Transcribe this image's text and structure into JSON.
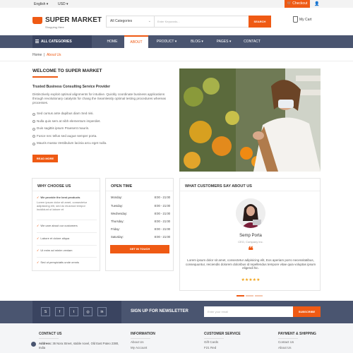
{
  "topbar": {
    "language": "English",
    "currency": "USD",
    "checkout": "Checkout"
  },
  "header": {
    "logo_name": "SUPER MARKET",
    "logo_tagline": "Shopping Here",
    "search_category": "All Categories",
    "search_placeholder": "Enter Keywords...",
    "search_button": "SEARCH",
    "cart_label": "My Cart"
  },
  "nav": {
    "all_categories": "ALL CATEGORIES",
    "items": [
      {
        "label": "HOME"
      },
      {
        "label": "ABOUT",
        "active": true
      },
      {
        "label": "PRODUCT ▾"
      },
      {
        "label": "BLOG ▾"
      },
      {
        "label": "PAGES ▾"
      },
      {
        "label": "CONTACT"
      }
    ]
  },
  "breadcrumb": {
    "home": "Home",
    "sep": "|",
    "current": "About Us"
  },
  "welcome": {
    "title": "WELCOME TO SUPER MARKET",
    "subtitle": "Trusted Business Consulting Service Provider",
    "paragraph": "Distinctively exploit optimal alignments for intuitive. Quickly coordinate business applications through revolutionary catalysts for chang the Seamlessly optimal testing procedures whereas processes.",
    "bullets": [
      "Sed cursus ante dapibus diam Sed nisi.",
      "Nulla quis sem at nibh elementum imperdiet.",
      "Duis sagittis ipsum Praesent mauris.",
      "Fusce nec tellus sed augue semper porta.",
      "Mauris massa Vestibulum lacinia arcu eget nulla."
    ],
    "read_more": "READ MORE"
  },
  "why_choose": {
    "title": "WHY CHOOSE US",
    "items": [
      {
        "head": "We provide the best products",
        "body": "Lorem ipsum dolor sit amet, consectetur adipisicing elit, sed do eiusmod tempor incididunt ut labore et"
      },
      {
        "head": "We care about our customers",
        "body": ""
      },
      {
        "head": "Labore et dolore aliqua",
        "body": ""
      },
      {
        "head": "Ut enim ad minim veniam",
        "body": ""
      },
      {
        "head": "Sed ut perspiciatis unde omnis",
        "body": ""
      }
    ]
  },
  "open_time": {
    "title": "OPEN TIME",
    "rows": [
      {
        "day": "Monday:",
        "time": "8:00 - 21:00"
      },
      {
        "day": "Tuesday:",
        "time": "8:00 - 21:00"
      },
      {
        "day": "Wednesday:",
        "time": "8:00 - 21:00"
      },
      {
        "day": "Thursday:",
        "time": "8:00 - 21:00"
      },
      {
        "day": "Friday:",
        "time": "8:00 - 21:00"
      },
      {
        "day": "Saturday:",
        "time": "8:00 - 21:00"
      }
    ],
    "button": "GET IN TOUCH"
  },
  "testimonial": {
    "title": "WHAT CUSTOMERS SAY ABOUT US",
    "name": "Semp Porta",
    "role": "CEO, Company Inc.",
    "quote_mark": "❝",
    "text": "Lorem ipsum dolor sit amet, consectetur adipisicing elit, Eos aperiam porro necessitatibus, consequuntur, reiciendis dolorem doloribus id repellendus tempore vitae quia voluptas ipsum eligendi hic.",
    "stars": "★★★★★",
    "rating": 4.5
  },
  "newsletter": {
    "title": "SIGN UP FOR NEWSLETTER",
    "email_placeholder": "Enter your email",
    "button": "SUBSCRIBE",
    "social": [
      "skype-icon",
      "facebook-icon",
      "twitter-icon",
      "instagram-icon",
      "linkedin-icon"
    ]
  },
  "footer": {
    "contact_title": "CONTACT US",
    "address_label": "Address:",
    "address": "36 Nora Street, stable novel, Old East Pateo 2380, India",
    "information_title": "INFORMATION",
    "information_links": [
      "About Us",
      "My Account"
    ],
    "service_title": "CUSTOMER SERVICE",
    "service_links": [
      "Gift Cards",
      "F21 Red"
    ],
    "payment_title": "PAYMENT & SHIPPING",
    "payment_links": [
      "Contact Us",
      "About Us"
    ]
  },
  "colors": {
    "accent": "#ef5a14",
    "nav": "#4a5570",
    "nav_dark": "#3a4460"
  }
}
